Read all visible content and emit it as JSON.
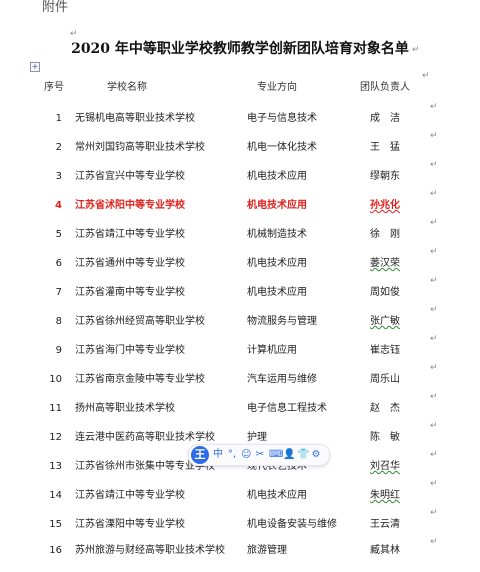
{
  "document": {
    "attachment_label": "附件",
    "title": "2020 年中等职业学校教师教学创新团队培育对象名单"
  },
  "table": {
    "headers": [
      "序号",
      "学校名称",
      "专业方向",
      "团队负责人"
    ],
    "rows": [
      {
        "no": "1",
        "school": "无锡机电高等职业技术学校",
        "major": "电子与信息技术",
        "leader": "成　洁"
      },
      {
        "no": "2",
        "school": "常州刘国钧高等职业技术学校",
        "major": "机电一体化技术",
        "leader": "王　猛"
      },
      {
        "no": "3",
        "school": "江苏省宜兴中等专业学校",
        "major": "机电技术应用",
        "leader": "缪朝东"
      },
      {
        "no": "4",
        "school": "江苏省沭阳中等专业学校",
        "major": "机电技术应用",
        "leader": "孙兆化"
      },
      {
        "no": "5",
        "school": "江苏省靖江中等专业学校",
        "major": "机械制造技术",
        "leader": "徐　刚"
      },
      {
        "no": "6",
        "school": "江苏省通州中等专业学校",
        "major": "机电技术应用",
        "leader": "蒌汉荣"
      },
      {
        "no": "7",
        "school": "江苏省灌南中等专业学校",
        "major": "机电技术应用",
        "leader": "周如俊"
      },
      {
        "no": "8",
        "school": "江苏省徐州经贸高等职业学校",
        "major": "物流服务与管理",
        "leader": "张广敏"
      },
      {
        "no": "9",
        "school": "江苏省海门中等专业学校",
        "major": "计算机应用",
        "leader": "崔志钰"
      },
      {
        "no": "10",
        "school": "江苏省南京金陵中等专业学校",
        "major": "汽车运用与维修",
        "leader": "周乐山"
      },
      {
        "no": "11",
        "school": "扬州高等职业技术学校",
        "major": "电子信息工程技术",
        "leader": "赵　杰"
      },
      {
        "no": "12",
        "school": "连云港中医药高等职业技术学校",
        "major": "护理",
        "leader": "陈　敏"
      },
      {
        "no": "13",
        "school": "江苏省徐州市张集中等专业学校",
        "major": "现代农艺技术",
        "leader": "刘召华"
      },
      {
        "no": "14",
        "school": "江苏省靖江中等专业学校",
        "major": "机电技术应用",
        "leader": "朱明红"
      },
      {
        "no": "15",
        "school": "江苏省溧阳中等专业学校",
        "major": "机电设备安装与维修",
        "leader": "王云清"
      },
      {
        "no": "16",
        "school": "苏州旅游与财经高等职业技术学校",
        "major": "旅游管理",
        "leader": "臧其林"
      }
    ],
    "highlight_color": "#e0201b"
  },
  "ime_toolbar": {
    "logo": "王",
    "mode_label": "中",
    "punct_label": "°,",
    "accent_color": "#2c6ce5"
  }
}
